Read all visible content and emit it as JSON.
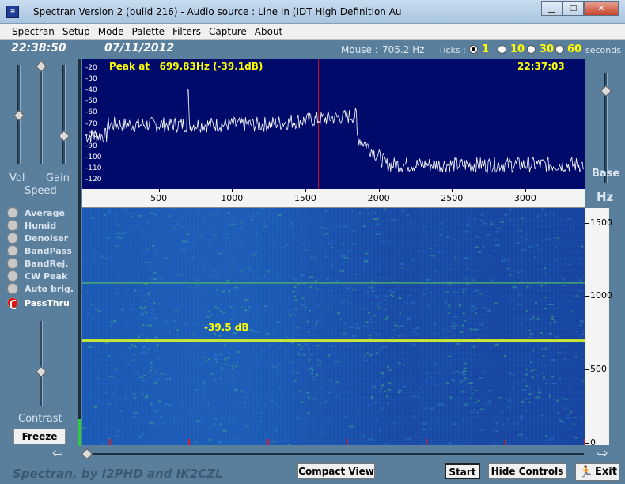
{
  "window": {
    "title": "Spectran Version 2 (build 216) - Audio source  :  Line In (IDT High Definition Au",
    "icon": "app-icon"
  },
  "menu": [
    {
      "label": "Spectran",
      "u": "S"
    },
    {
      "label": "Setup",
      "u": "S"
    },
    {
      "label": "Mode",
      "u": "M"
    },
    {
      "label": "Palette",
      "u": "P"
    },
    {
      "label": "Filters",
      "u": "F"
    },
    {
      "label": "Capture",
      "u": "C"
    },
    {
      "label": "About",
      "u": "A"
    }
  ],
  "info": {
    "clock": "22:38:50",
    "date": "07/11/2012",
    "mouse_label": "Mouse :",
    "mouse_value": "705.2 Hz",
    "ticks_label": "Ticks :",
    "ticks_options": [
      "1",
      "10",
      "30",
      "60"
    ],
    "ticks_selected": "1",
    "seconds_label": "seconds"
  },
  "left_panel": {
    "vol_label": "Vol",
    "gain_label": "Gain",
    "speed_label": "Speed",
    "contrast_label": "Contrast",
    "freeze_label": "Freeze",
    "options": [
      {
        "label": "Average",
        "on": false
      },
      {
        "label": "Humid",
        "on": false
      },
      {
        "label": "Denoiser",
        "on": false
      },
      {
        "label": "BandPass",
        "on": false
      },
      {
        "label": "BandRej.",
        "on": false
      },
      {
        "label": "CW Peak",
        "on": false
      },
      {
        "label": "Auto brig.",
        "on": false
      },
      {
        "label": "PassThru",
        "on": true
      }
    ]
  },
  "spectrum": {
    "peak_text": "Peak at   699.83Hz (-39.1dB)",
    "time_text": "22:37:03",
    "y_ticks": [
      "-20",
      "-30",
      "-40",
      "-50",
      "-60",
      "-70",
      "-80",
      "-90",
      "-100",
      "-110",
      "-120"
    ],
    "x_ticks": [
      "500",
      "1000",
      "1500",
      "2000",
      "2500",
      "3000"
    ],
    "cursor_hz": 1590,
    "freq_max": 3400,
    "colors": {
      "bg": "#000a6a",
      "trace": "#ffffff",
      "cursor": "#d01818",
      "label": "#ffff00"
    }
  },
  "waterfall": {
    "db_label": "-39.5 dB",
    "y_ticks": [
      "1500",
      "1000",
      "500",
      "0"
    ],
    "hz_label": "Hz",
    "base_label": "Base",
    "signal_hz": 700,
    "harmonic_hz": 1095,
    "colors": {
      "signal": "#c8e632",
      "harmonic": "#4caf6a"
    }
  },
  "bottom": {
    "credit": "Spectran, by I2PHD and IK2CZL",
    "compact_view": "Compact View",
    "start": "Start",
    "hide_controls": "Hide Controls",
    "exit": "Exit"
  }
}
